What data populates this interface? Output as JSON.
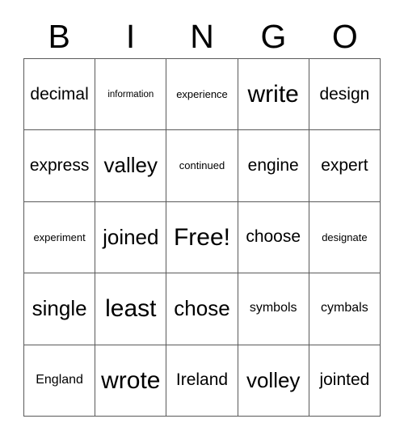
{
  "card": {
    "title": "BINGO",
    "free_space_label": "Free!",
    "border_color": "#5a5a5a",
    "background_color": "#ffffff",
    "text_color": "#000000",
    "columns": 5,
    "rows": 5
  },
  "header": {
    "letters": [
      {
        "label": "B"
      },
      {
        "label": "I"
      },
      {
        "label": "N"
      },
      {
        "label": "G"
      },
      {
        "label": "O"
      }
    ]
  },
  "grid": {
    "cells": [
      {
        "label": "decimal",
        "size": "sz-md",
        "free": false
      },
      {
        "label": "information",
        "size": "sz-xxs",
        "free": false
      },
      {
        "label": "experience",
        "size": "sz-xs",
        "free": false
      },
      {
        "label": "write",
        "size": "sz-xl",
        "free": false
      },
      {
        "label": "design",
        "size": "sz-md",
        "free": false
      },
      {
        "label": "express",
        "size": "sz-md",
        "free": false
      },
      {
        "label": "valley",
        "size": "sz-lg",
        "free": false
      },
      {
        "label": "continued",
        "size": "sz-xs",
        "free": false
      },
      {
        "label": "engine",
        "size": "sz-md",
        "free": false
      },
      {
        "label": "expert",
        "size": "sz-md",
        "free": false
      },
      {
        "label": "experiment",
        "size": "sz-xs",
        "free": false
      },
      {
        "label": "joined",
        "size": "sz-lg",
        "free": false
      },
      {
        "label": "Free!",
        "size": "sz-xl",
        "free": true
      },
      {
        "label": "choose",
        "size": "sz-md",
        "free": false
      },
      {
        "label": "designate",
        "size": "sz-xs",
        "free": false
      },
      {
        "label": "single",
        "size": "sz-lg",
        "free": false
      },
      {
        "label": "least",
        "size": "sz-xl",
        "free": false
      },
      {
        "label": "chose",
        "size": "sz-lg",
        "free": false
      },
      {
        "label": "symbols",
        "size": "sz-sm",
        "free": false
      },
      {
        "label": "cymbals",
        "size": "sz-sm",
        "free": false
      },
      {
        "label": "England",
        "size": "sz-sm",
        "free": false
      },
      {
        "label": "wrote",
        "size": "sz-xl",
        "free": false
      },
      {
        "label": "Ireland",
        "size": "sz-md",
        "free": false
      },
      {
        "label": "volley",
        "size": "sz-lg",
        "free": false
      },
      {
        "label": "jointed",
        "size": "sz-md",
        "free": false
      }
    ]
  }
}
